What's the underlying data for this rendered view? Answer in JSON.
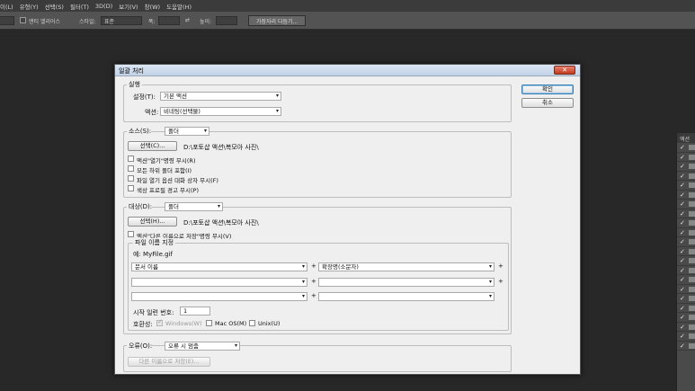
{
  "menubar": {
    "items": [
      "이(L)",
      "유형(Y)",
      "선택(S)",
      "필터(T)",
      "3D(D)",
      "보기(V)",
      "창(W)",
      "도움말(H)"
    ]
  },
  "options_bar": {
    "anti_alias_label": "앤티 앨리어스",
    "style_label": "스타일:",
    "style_value": "표준",
    "width_label": "폭:",
    "height_label": "높이:",
    "refine_button": "가장자리 다듬기..."
  },
  "panel": {
    "title": "액션"
  },
  "dialog": {
    "title": "일괄 처리",
    "ok_label": "확인",
    "cancel_label": "취소",
    "run": {
      "legend": "실행",
      "set_label": "설정(T):",
      "set_value": "기본 액션",
      "action_label": "액션:",
      "action_value": "비네팅(선택물)"
    },
    "source": {
      "label": "소스(S):",
      "value": "폴더",
      "choose_label": "선택(C)...",
      "path": "D:\\포토샵 액션\\복모아 사진\\",
      "options": [
        {
          "label": "액션\"열기\"명령 무시(R)",
          "checked": false
        },
        {
          "label": "모든 하위 폴더 포함(I)",
          "checked": false
        },
        {
          "label": "파일 열기 옵션 대화 상자 무시(F)",
          "checked": false
        },
        {
          "label": "색상 프로필 경고 무시(P)",
          "checked": false
        }
      ]
    },
    "destination": {
      "label": "대상(D):",
      "value": "폴더",
      "choose_label": "선택(H)...",
      "path": "D:\\포토샵 액션\\복모아 사진\\",
      "override_label": "액션\"다른 이름으로 저장\"명령 무시(V)",
      "naming": {
        "legend": "파일 이름 지정",
        "example": "예: MyFile.gif",
        "rows": [
          {
            "left": "문서 이름",
            "right": "확장명(소문자)"
          },
          {
            "left": "",
            "right": ""
          },
          {
            "left": "",
            "right": ""
          }
        ],
        "plus": "+",
        "serial_label": "시작 일련 번호:",
        "serial_value": "1",
        "compat_label": "호환성:",
        "compat": [
          {
            "label": "Windows(W)",
            "checked": true,
            "disabled": true
          },
          {
            "label": "Mac OS(M)",
            "checked": false,
            "disabled": false
          },
          {
            "label": "Unix(U)",
            "checked": false,
            "disabled": false
          }
        ]
      }
    },
    "errors": {
      "label": "오류(O):",
      "value": "오류 시 멈춤",
      "save_as_label": "다른 이름으로 저장(E)..."
    }
  }
}
